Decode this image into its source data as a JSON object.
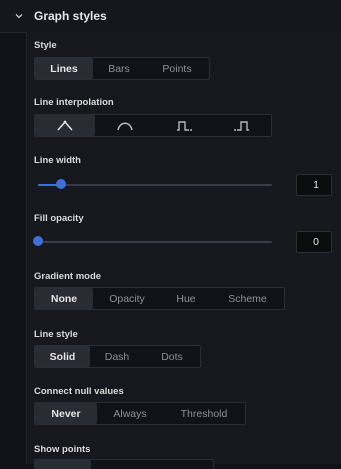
{
  "header": {
    "title": "Graph styles",
    "icon": "chevron-down-icon"
  },
  "style": {
    "label": "Style",
    "options": [
      "Lines",
      "Bars",
      "Points"
    ],
    "selected": "Lines"
  },
  "line_interpolation": {
    "label": "Line interpolation",
    "options": [
      {
        "icon": "linear-interpolation-icon"
      },
      {
        "icon": "smooth-interpolation-icon"
      },
      {
        "icon": "step-before-icon"
      },
      {
        "icon": "step-after-icon"
      }
    ],
    "selected_index": 0
  },
  "line_width": {
    "label": "Line width",
    "value": "1",
    "slider_fraction": 0.1
  },
  "fill_opacity": {
    "label": "Fill opacity",
    "value": "0",
    "slider_fraction": 0
  },
  "gradient_mode": {
    "label": "Gradient mode",
    "options": [
      "None",
      "Opacity",
      "Hue",
      "Scheme"
    ],
    "selected": "None"
  },
  "line_style": {
    "label": "Line style",
    "options": [
      "Solid",
      "Dash",
      "Dots"
    ],
    "selected": "Solid"
  },
  "connect_null_values": {
    "label": "Connect null values",
    "options": [
      "Never",
      "Always",
      "Threshold"
    ],
    "selected": "Never"
  },
  "show_points": {
    "label": "Show points"
  },
  "colors": {
    "accent": "#3d71d9",
    "background": "#111217",
    "panel": "#17181d"
  }
}
